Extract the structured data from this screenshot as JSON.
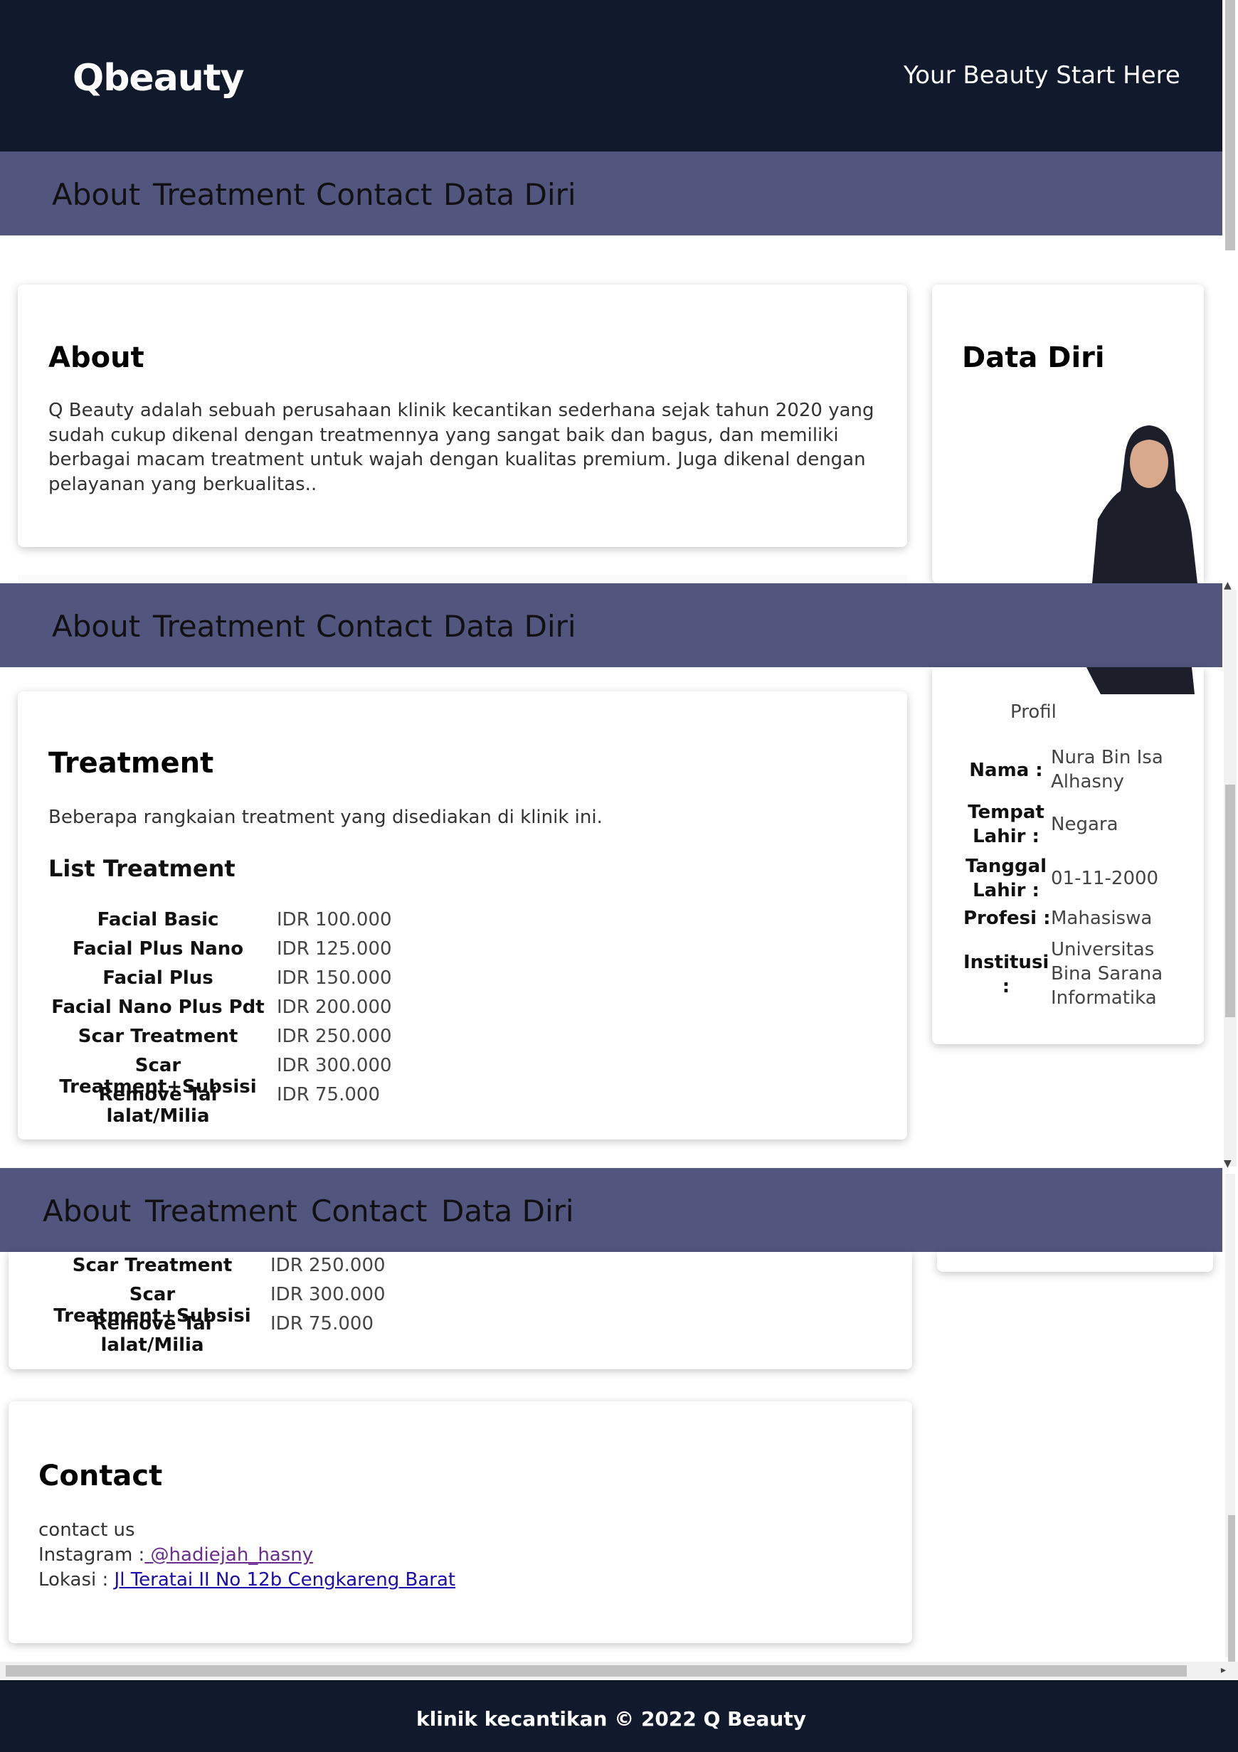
{
  "header": {
    "logo": "Qbeauty",
    "tagline": "Your Beauty Start Here"
  },
  "nav": {
    "items": [
      "About",
      "Treatment",
      "Contact",
      "Data Diri"
    ]
  },
  "about": {
    "title": "About",
    "lines": [
      "Q Beauty adalah sebuah perusahaan klinik kecantikan sederhana sejak tahun 2020 yang",
      "sudah cukup dikenal dengan treatmennya yang sangat baik dan bagus, dan memiliki",
      "berbagai macam treatment untuk wajah dengan kualitas premium. Juga dikenal dengan",
      "pelayanan yang berkualitas.."
    ]
  },
  "treatment": {
    "title": "Treatment",
    "desc": "Beberapa rangkaian treatment yang disediakan di klinik ini.",
    "list_title": "List Treatment",
    "items": [
      {
        "name": "Facial Basic",
        "price": "IDR 100.000"
      },
      {
        "name": "Facial Plus Nano",
        "price": "IDR 125.000"
      },
      {
        "name": "Facial Plus",
        "price": "IDR 150.000"
      },
      {
        "name": "Facial Nano Plus Pdt",
        "price": "IDR 200.000"
      },
      {
        "name": "Scar Treatment",
        "price": "IDR 250.000"
      },
      {
        "name": "Scar Treatment+Subsisi",
        "price": "IDR 300.000"
      },
      {
        "name": "Remove Tai lalat/Milia",
        "price": "IDR 75.000"
      }
    ]
  },
  "datadiri": {
    "title": "Data Diri",
    "profil_caption": "Profil",
    "rows": [
      {
        "label": "Nama :",
        "value": "Nura Bin Isa Alhasny"
      },
      {
        "label": "Tempat Lahir :",
        "value": "Negara"
      },
      {
        "label": "Tanggal Lahir :",
        "value": "01-11-2000"
      },
      {
        "label": "Profesi :",
        "value": "Mahasiswa"
      },
      {
        "label": "Institusi :",
        "value": "Universitas Bina Sarana Informatika"
      }
    ]
  },
  "contact": {
    "title": "Contact",
    "intro": "contact us",
    "instagram_label": "Instagram :",
    "instagram_link": " @hadiejah_hasny",
    "lokasi_label": "Lokasi : ",
    "lokasi_link": "Jl Teratai II No 12b Cengkareng Barat"
  },
  "footer": {
    "text": "klinik kecantikan © 2022 Q Beauty"
  }
}
